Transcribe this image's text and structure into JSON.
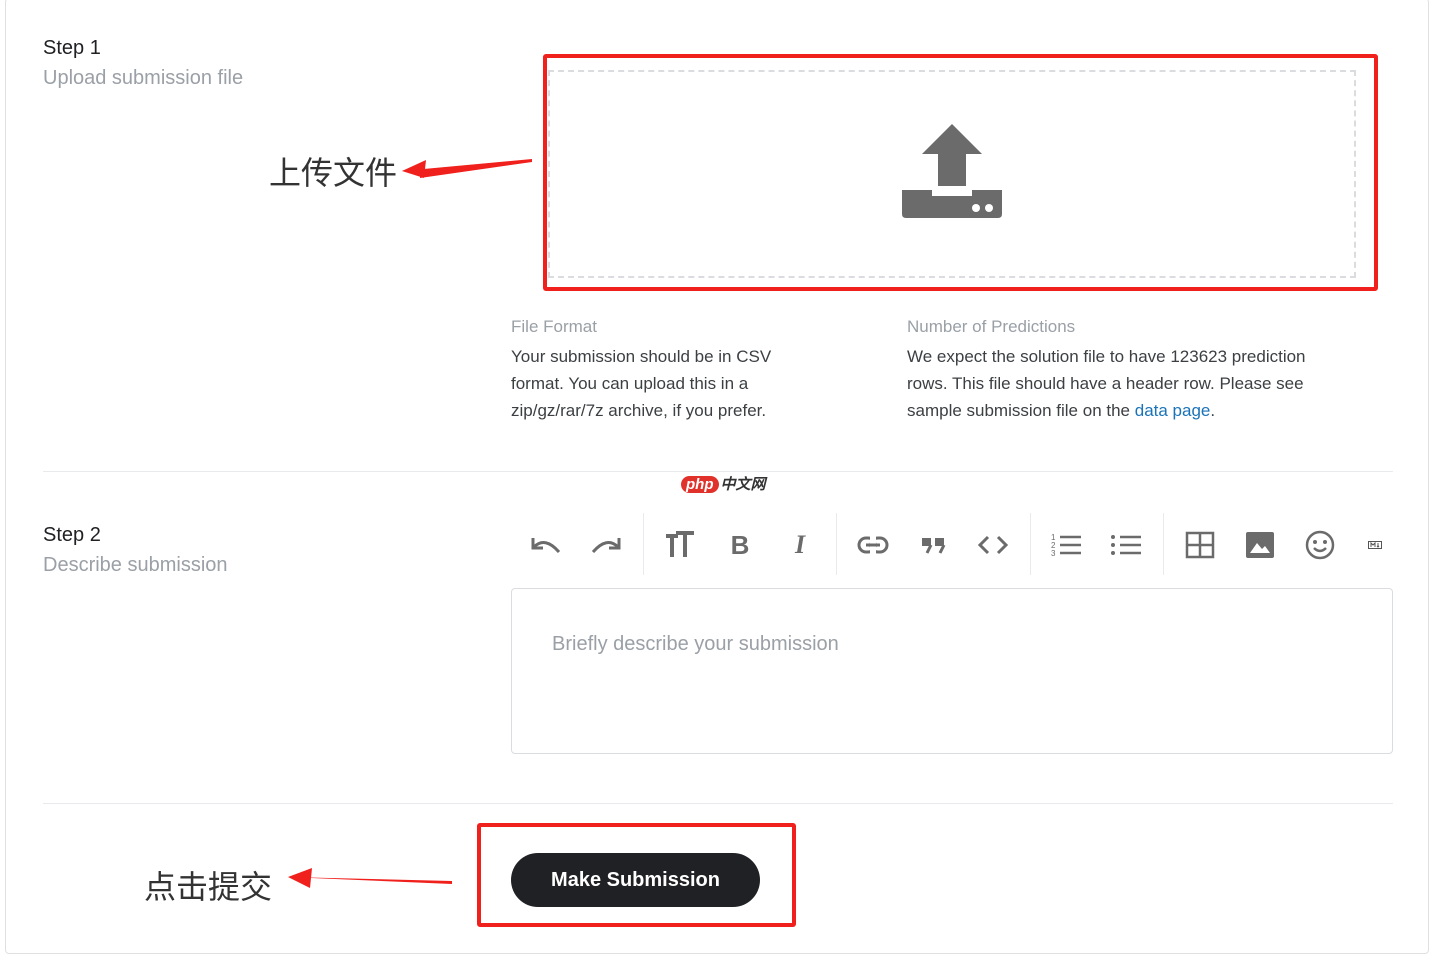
{
  "step1": {
    "title": "Step 1",
    "subtitle": "Upload submission file"
  },
  "dropzone": {
    "icon": "upload-icon"
  },
  "file_format": {
    "label": "File Format",
    "lines": [
      "Your submission should be in CSV",
      "format. You can upload this in a",
      "zip/gz/rar/7z archive, if you prefer."
    ]
  },
  "predictions": {
    "label": "Number of Predictions",
    "line1": "We expect the solution file to have 123623 prediction",
    "line2": "rows. This file should have a header row. Please see",
    "line3_prefix": "sample submission file on the ",
    "link_text": "data page",
    "line3_suffix": "."
  },
  "watermark": {
    "badge": "php",
    "text": "中文网"
  },
  "step2": {
    "title": "Step 2",
    "subtitle": "Describe submission"
  },
  "toolbar": {
    "icons": [
      "undo-icon",
      "redo-icon",
      "text-size-icon",
      "bold-icon",
      "italic-icon",
      "link-icon",
      "quote-icon",
      "code-icon",
      "ordered-list-icon",
      "bullet-list-icon",
      "table-icon",
      "image-icon",
      "emoji-icon",
      "markdown-icon"
    ],
    "bold_glyph": "B",
    "italic_glyph": "I"
  },
  "editor": {
    "value": "",
    "placeholder": "Briefly describe your submission"
  },
  "submit": {
    "label": "Make Submission"
  },
  "annotations": {
    "upload_note": "上传文件",
    "submit_note": "点击提交",
    "highlight_color": "#f0201c"
  }
}
